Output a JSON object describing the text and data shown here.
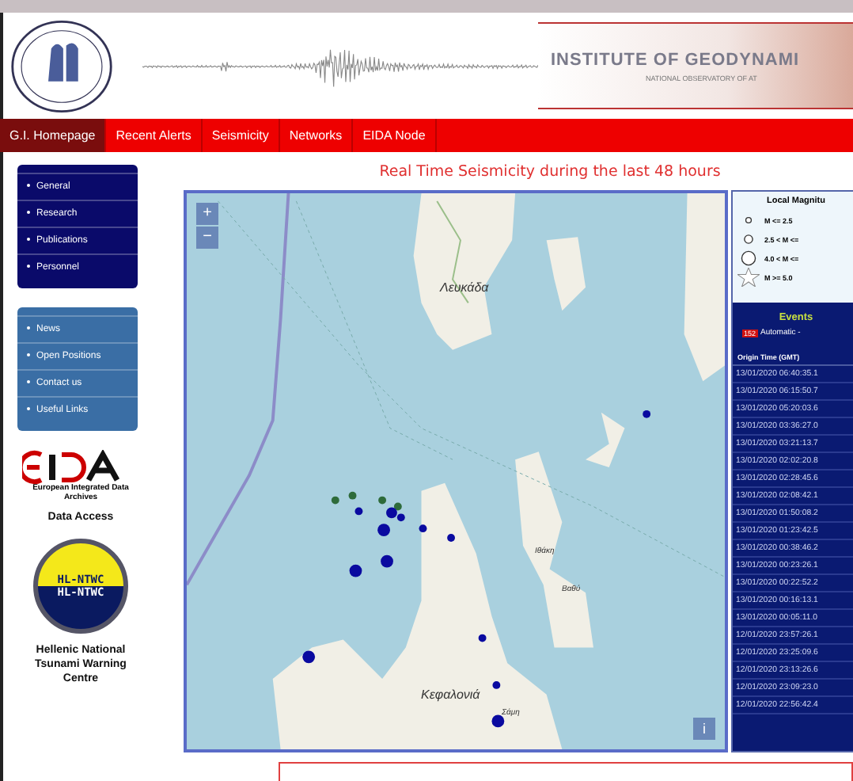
{
  "header": {
    "title": "INSTITUTE OF GEODYNAMI",
    "subtitle": "NATIONAL OBSERVATORY OF AT"
  },
  "nav": [
    {
      "label": "G.I. Homepage",
      "selected": true
    },
    {
      "label": "Recent Alerts",
      "selected": false
    },
    {
      "label": "Seismicity",
      "selected": false
    },
    {
      "label": "Networks",
      "selected": false
    },
    {
      "label": "EIDA Node",
      "selected": false
    }
  ],
  "sidebar": {
    "menus": [
      {
        "kind": "dark",
        "items": [
          "General",
          "Research",
          "Publications",
          "Personnel"
        ]
      },
      {
        "kind": "light",
        "items": [
          "News",
          "Open Positions",
          "Contact us",
          "Useful Links"
        ]
      }
    ],
    "eida_caption": "European Integrated Data Archives",
    "eida_link": "Data Access",
    "tsunami_logo": [
      "HL-NTWC",
      "HL-NTWC"
    ],
    "tsunami_link": "Hellenic National Tsunami Warning Centre"
  },
  "main": {
    "heading": "Real Time Seismicity during the last 48 hours",
    "map": {
      "zoom_in": "+",
      "zoom_out": "−",
      "info": "i",
      "places": [
        {
          "name": "Λευκάδα",
          "kind": "island"
        },
        {
          "name": "Ιθάκη",
          "kind": "town"
        },
        {
          "name": "Βαθύ",
          "kind": "town"
        },
        {
          "name": "Κεφαλονιά",
          "kind": "island"
        },
        {
          "name": "Σάμη",
          "kind": "town"
        }
      ]
    }
  },
  "panel": {
    "legend_title": "Local Magnitu",
    "legend": [
      {
        "label": "M <= 2.5",
        "kind": "small"
      },
      {
        "label": "2.5 < M <=",
        "kind": "medium"
      },
      {
        "label": "4.0 < M <=",
        "kind": "large"
      },
      {
        "label": "M >= 5.0",
        "kind": "star"
      }
    ],
    "events_title": "Events",
    "events_count": "152",
    "events_note": "Automatic -",
    "column": "Origin Time (GMT)",
    "rows": [
      "13/01/2020 06:40:35.1",
      "13/01/2020 06:15:50.7",
      "13/01/2020 05:20:03.6",
      "13/01/2020 03:36:27.0",
      "13/01/2020 03:21:13.7",
      "13/01/2020 02:02:20.8",
      "13/01/2020 02:28:45.6",
      "13/01/2020 02:08:42.1",
      "13/01/2020 01:50:08.2",
      "13/01/2020 01:23:42.5",
      "13/01/2020 00:38:46.2",
      "13/01/2020 00:23:26.1",
      "13/01/2020 00:22:52.2",
      "13/01/2020 00:16:13.1",
      "13/01/2020 00:05:11.0",
      "12/01/2020 23:57:26.1",
      "12/01/2020 23:25:09.6",
      "12/01/2020 23:13:26.6",
      "12/01/2020 23:09:23.0",
      "12/01/2020 22:56:42.4"
    ]
  }
}
